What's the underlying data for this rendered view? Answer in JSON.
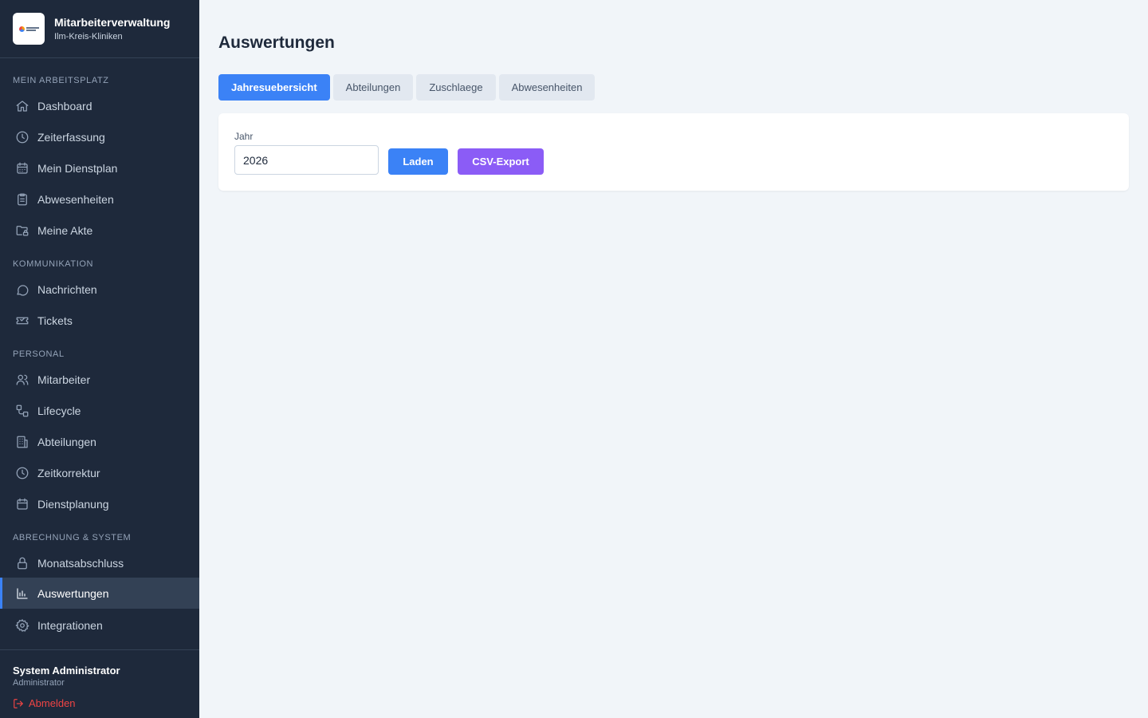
{
  "brand": {
    "title": "Mitarbeiterverwaltung",
    "subtitle": "Ilm-Kreis-Kliniken"
  },
  "sidebar": {
    "sections": [
      {
        "title": "MEIN ARBEITSPLATZ",
        "items": [
          {
            "label": "Dashboard",
            "icon": "home-icon"
          },
          {
            "label": "Zeiterfassung",
            "icon": "clock-icon"
          },
          {
            "label": "Mein Dienstplan",
            "icon": "calendar-icon"
          },
          {
            "label": "Abwesenheiten",
            "icon": "clipboard-icon"
          },
          {
            "label": "Meine Akte",
            "icon": "folder-lock-icon"
          }
        ]
      },
      {
        "title": "KOMMUNIKATION",
        "items": [
          {
            "label": "Nachrichten",
            "icon": "message-icon"
          },
          {
            "label": "Tickets",
            "icon": "ticket-icon"
          }
        ]
      },
      {
        "title": "PERSONAL",
        "items": [
          {
            "label": "Mitarbeiter",
            "icon": "users-icon"
          },
          {
            "label": "Lifecycle",
            "icon": "workflow-icon"
          },
          {
            "label": "Abteilungen",
            "icon": "building-icon"
          },
          {
            "label": "Zeitkorrektur",
            "icon": "clock-icon"
          },
          {
            "label": "Dienstplanung",
            "icon": "calendar-icon"
          }
        ]
      },
      {
        "title": "ABRECHNUNG & SYSTEM",
        "items": [
          {
            "label": "Monatsabschluss",
            "icon": "lock-icon"
          },
          {
            "label": "Auswertungen",
            "icon": "bar-chart-icon",
            "active": true
          },
          {
            "label": "Integrationen",
            "icon": "gear-icon"
          }
        ]
      }
    ]
  },
  "user": {
    "name": "System Administrator",
    "role": "Administrator",
    "logout_label": "Abmelden"
  },
  "main": {
    "title": "Auswertungen",
    "tabs": [
      {
        "label": "Jahresuebersicht",
        "active": true
      },
      {
        "label": "Abteilungen"
      },
      {
        "label": "Zuschlaege"
      },
      {
        "label": "Abwesenheiten"
      }
    ],
    "filter": {
      "year_label": "Jahr",
      "year_value": "2026",
      "load_label": "Laden",
      "export_label": "CSV-Export"
    }
  },
  "colors": {
    "sidebar_bg": "#1e293b",
    "accent": "#3b82f6",
    "export": "#8b5cf6",
    "logout": "#ef4444",
    "page_bg": "#f1f5f9"
  }
}
